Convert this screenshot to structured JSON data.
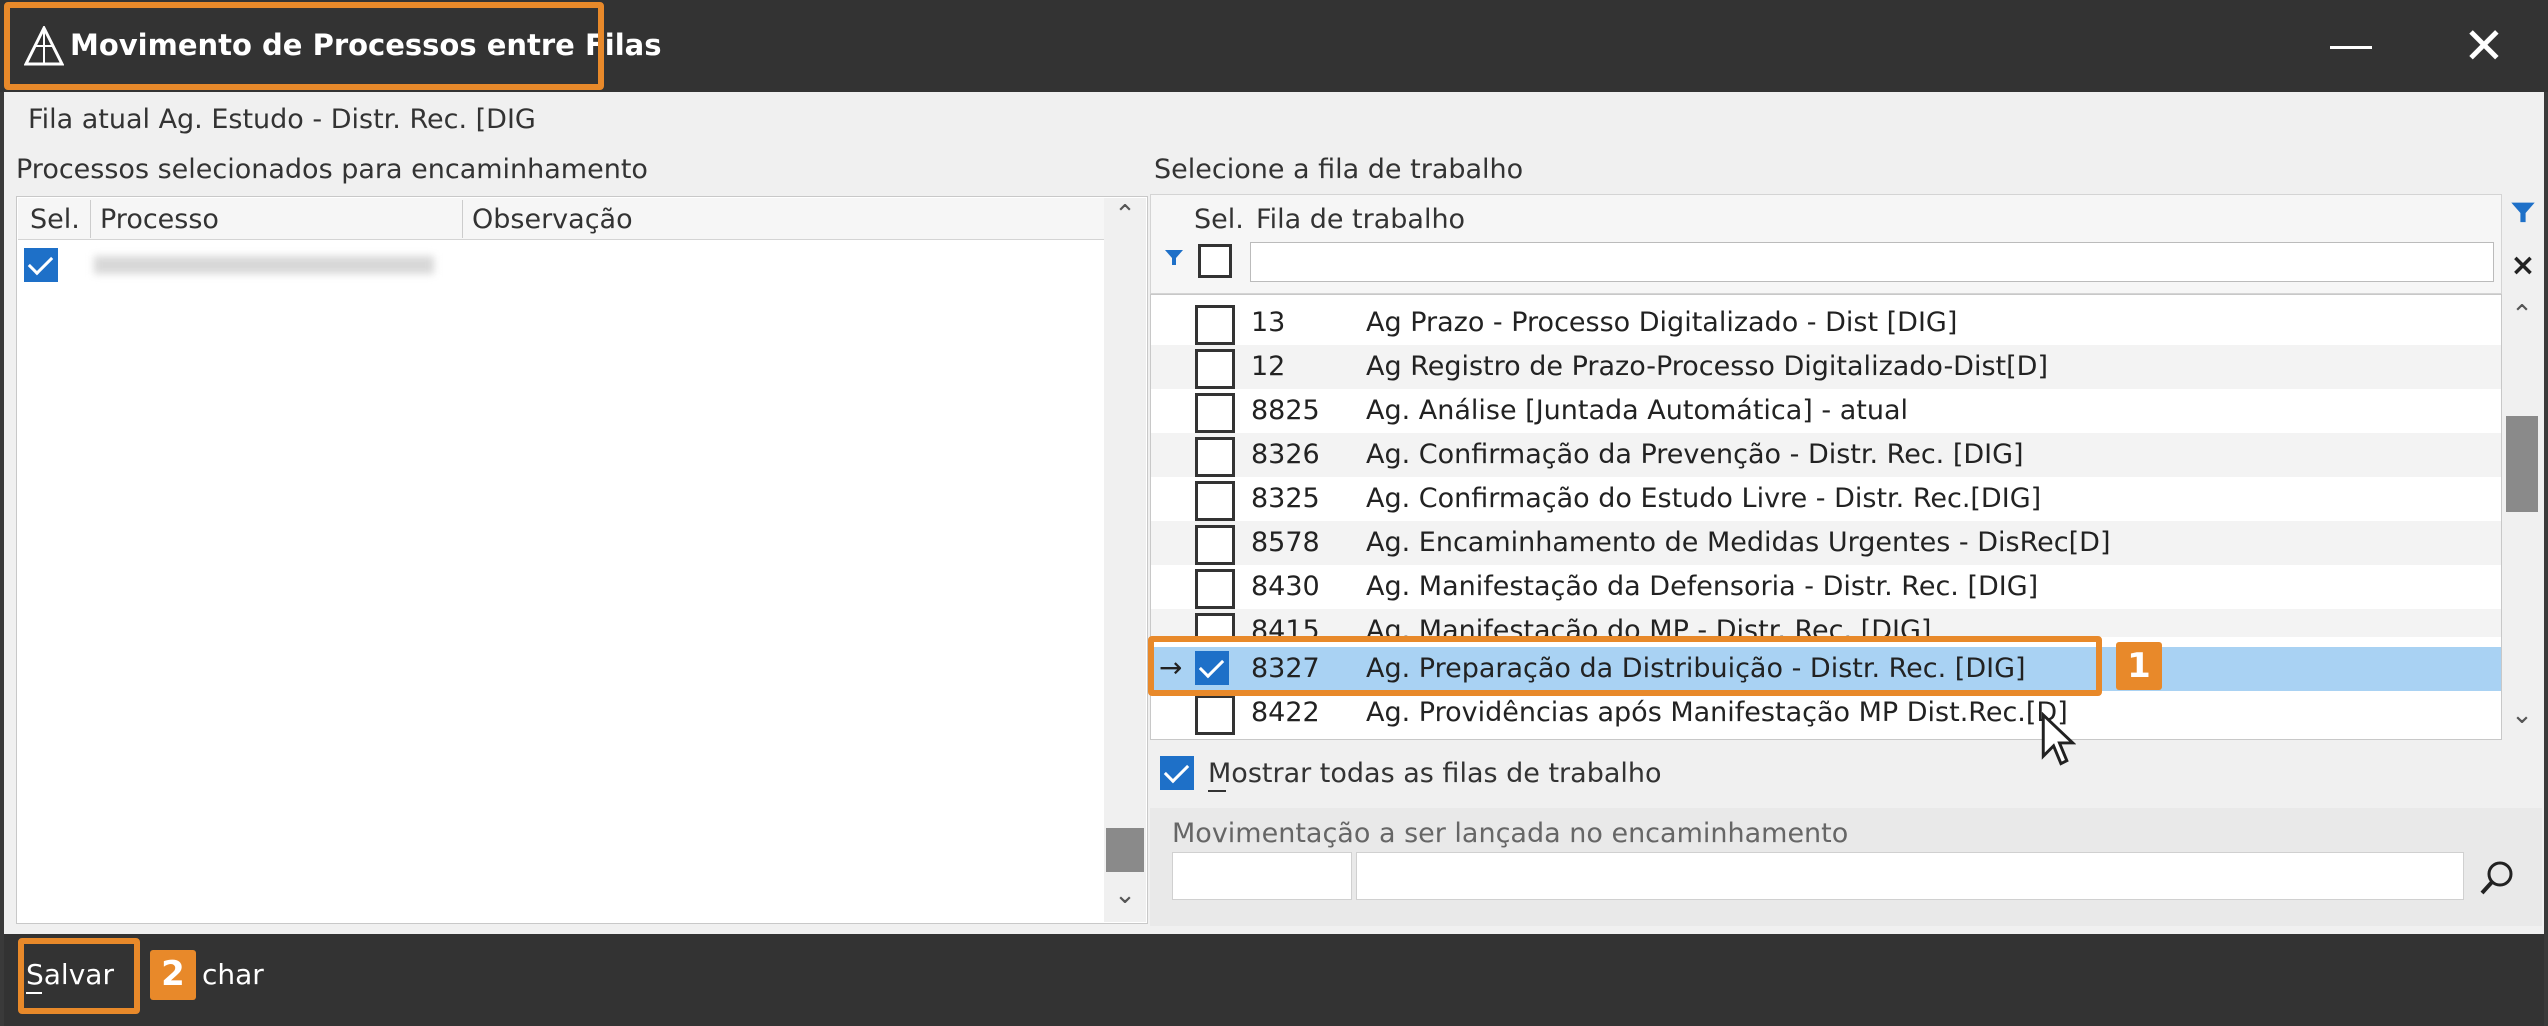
{
  "window": {
    "title": "Movimento de Processos entre Filas",
    "minimize_icon": "minimize-icon",
    "close_icon": "close-icon"
  },
  "current_queue": "Fila atual Ag. Estudo - Distr. Rec. [DIG",
  "left_panel": {
    "title": "Processos selecionados para encaminhamento",
    "columns": [
      "Sel.",
      "Processo",
      "Observação"
    ],
    "rows": [
      {
        "selected": true,
        "processo": "",
        "observacao": ""
      }
    ]
  },
  "right_panel": {
    "title": "Selecione a fila de trabalho",
    "columns": [
      "Sel.",
      "Fila de trabalho"
    ],
    "filter_value": "",
    "rows": [
      {
        "num": "13",
        "name": "Ag Prazo - Processo Digitalizado - Dist [DIG]",
        "checked": false
      },
      {
        "num": "12",
        "name": "Ag Registro de Prazo-Processo Digitalizado-Dist[D]",
        "checked": false
      },
      {
        "num": "8825",
        "name": "Ag. Análise [Juntada Automática] - atual",
        "checked": false
      },
      {
        "num": "8326",
        "name": "Ag. Confirmação da Prevenção - Distr. Rec. [DIG]",
        "checked": false
      },
      {
        "num": "8325",
        "name": "Ag. Confirmação do Estudo Livre - Distr. Rec.[DIG]",
        "checked": false
      },
      {
        "num": "8578",
        "name": "Ag. Encaminhamento de Medidas Urgentes - DisRec[D]",
        "checked": false
      },
      {
        "num": "8430",
        "name": "Ag. Manifestação da Defensoria - Distr. Rec. [DIG]",
        "checked": false
      },
      {
        "num": "8415",
        "name": "Ag. Manifestação do MP - Distr. Rec. [DIG]",
        "checked": false
      },
      {
        "num": "8327",
        "name": "Ag. Preparação da Distribuição - Distr. Rec. [DIG]",
        "checked": true
      },
      {
        "num": "8422",
        "name": "Ag. Providências após Manifestação MP Dist.Rec.[D]",
        "checked": false
      }
    ],
    "show_all_label": "Mostrar todas as filas de trabalho",
    "show_all_checked": true,
    "movement_label": "Movimentação a ser lançada no encaminhamento",
    "movement_code": "",
    "movement_desc": ""
  },
  "callouts": {
    "one": "1",
    "two": "2"
  },
  "footer": {
    "save_label": "Salvar",
    "close_label": "char"
  },
  "colors": {
    "accent": "#e8892a",
    "selection": "#a9d2f3",
    "check": "#1e70c8",
    "titlebar": "#333333"
  }
}
